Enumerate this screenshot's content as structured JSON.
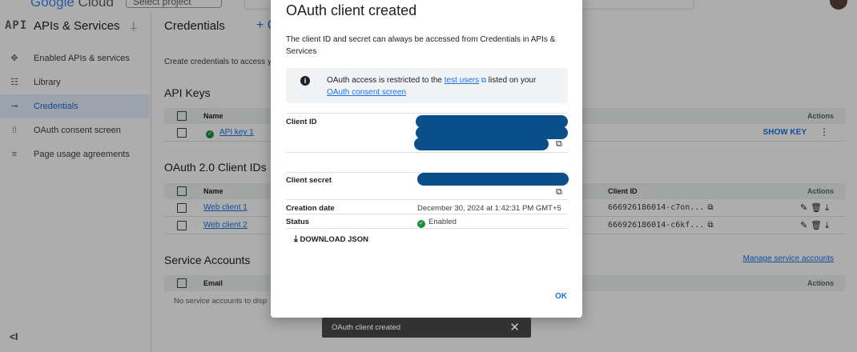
{
  "topbar": {
    "logo_g": "Google",
    "logo_rest": " Cloud",
    "project": "Select project",
    "icons": "◻ ◻ ◻ ◻ ◻"
  },
  "sidebar": {
    "logo": "API",
    "title": "APIs & Services",
    "pin": "⇩",
    "items": [
      {
        "label": "Enabled APIs & services",
        "icon": "✥"
      },
      {
        "label": "Library",
        "icon": "☷"
      },
      {
        "label": "Credentials",
        "icon": "⊸"
      },
      {
        "label": "OAuth consent screen",
        "icon": "⁞⁞"
      },
      {
        "label": "Page usage agreements",
        "icon": "≡"
      }
    ],
    "collapse": "<I"
  },
  "main": {
    "title": "Credentials",
    "create": "+ C",
    "description": "Create credentials to access y",
    "api_keys": {
      "heading": "API Keys",
      "col_name": "Name",
      "col_actions": "Actions",
      "rows": [
        {
          "name": "API key 1",
          "action": "SHOW KEY"
        }
      ]
    },
    "oauth": {
      "heading": "OAuth 2.0 Client IDs",
      "col_name": "Name",
      "col_client_id": "Client ID",
      "col_actions": "Actions",
      "rows": [
        {
          "name": "Web client 1",
          "client_id": "666926186014-c7on..."
        },
        {
          "name": "Web client 2",
          "client_id": "666926186014-c6kf..."
        }
      ]
    },
    "service_accounts": {
      "heading": "Service Accounts",
      "manage": "Manage service accounts",
      "col_email": "Email",
      "col_actions": "Actions",
      "empty": "No service accounts to disp"
    }
  },
  "dialog": {
    "title": "OAuth client created",
    "description": "The client ID and secret can always be accessed from Credentials in APIs & Services",
    "info_prefix": "OAuth access is restricted to the ",
    "info_link1": "test users",
    "info_middle": " listed on your ",
    "info_link2": "OAuth consent screen",
    "client_id_label": "Client ID",
    "client_secret_label": "Client secret",
    "creation_date_label": "Creation date",
    "creation_date_value": "December 30, 2024 at 1:42:31 PM GMT+5",
    "status_label": "Status",
    "status_value": "Enabled",
    "download": "DOWNLOAD JSON",
    "ok": "OK"
  },
  "snackbar": {
    "text": "OAuth client created",
    "close": "✕"
  },
  "colors": {
    "accent": "#1a73e8",
    "redaction": "#0b4f8a",
    "success": "#1e8e3e"
  }
}
